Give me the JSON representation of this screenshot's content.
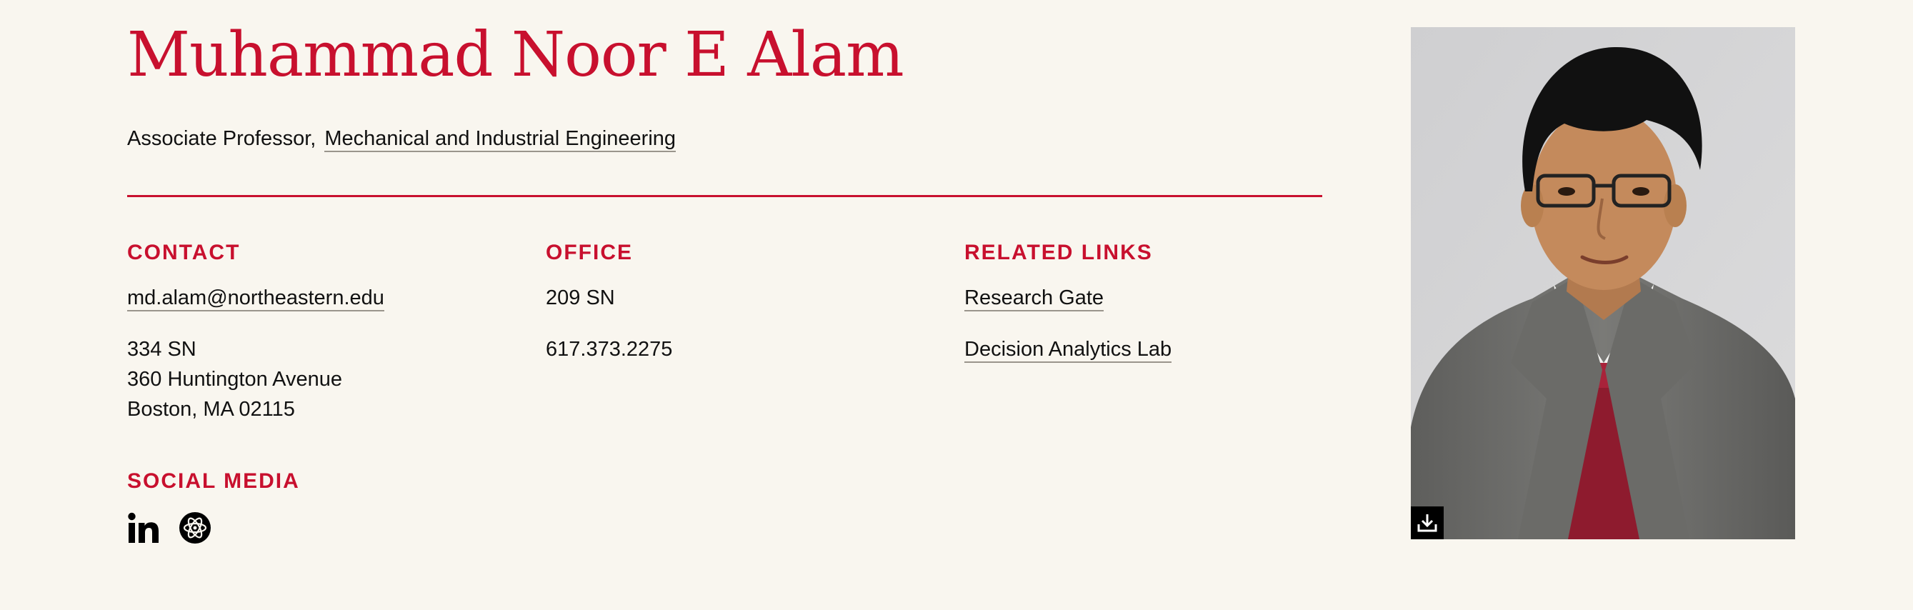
{
  "profile": {
    "name": "Muhammad Noor E Alam",
    "title": "Associate Professor,",
    "department": "Mechanical and Industrial Engineering"
  },
  "contact": {
    "heading": "CONTACT",
    "email": "md.alam@northeastern.edu",
    "address": [
      "334 SN",
      "360 Huntington Avenue",
      "Boston, MA 02115"
    ]
  },
  "office": {
    "heading": "OFFICE",
    "room": "209 SN",
    "phone": "617.373.2275"
  },
  "related_links": {
    "heading": "RELATED LINKS",
    "items": [
      "Research Gate",
      "Decision Analytics Lab"
    ]
  },
  "social": {
    "heading": "SOCIAL MEDIA",
    "icons": [
      "linkedin-icon",
      "researchgate-icon"
    ]
  },
  "photo": {
    "download_icon": "download-icon"
  },
  "colors": {
    "accent": "#c8102e",
    "background": "#f9f6ef",
    "text": "#111111"
  }
}
